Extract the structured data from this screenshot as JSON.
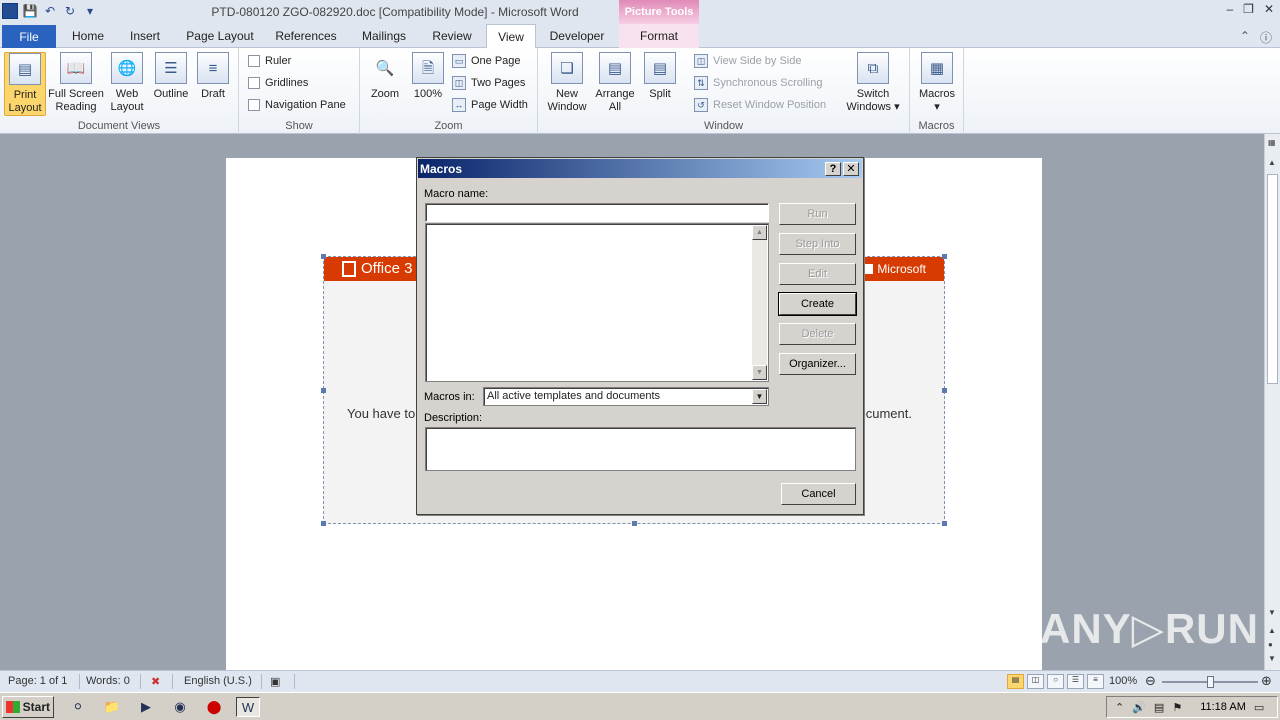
{
  "window": {
    "title": "PTD-080120 ZGO-082920.doc [Compatibility Mode]  -  Microsoft Word",
    "context_tab": "Picture Tools",
    "controls": [
      "–",
      "❐",
      "✕"
    ]
  },
  "tabs": [
    "File",
    "Home",
    "Insert",
    "Page Layout",
    "References",
    "Mailings",
    "Review",
    "View",
    "Developer",
    "Format"
  ],
  "ribbon": {
    "document_views": {
      "label": "Document Views",
      "buttons": [
        "Print\nLayout",
        "Full Screen\nReading",
        "Web\nLayout",
        "Outline",
        "Draft"
      ]
    },
    "show": {
      "label": "Show",
      "items": [
        "Ruler",
        "Gridlines",
        "Navigation Pane"
      ]
    },
    "zoom": {
      "label": "Zoom",
      "zoom_btn": "Zoom",
      "hundred_btn": "100%",
      "items": [
        "One Page",
        "Two Pages",
        "Page Width"
      ]
    },
    "window": {
      "label": "Window",
      "new_window": "New\nWindow",
      "arrange_all": "Arrange\nAll",
      "split": "Split",
      "items": [
        "View Side by Side",
        "Synchronous Scrolling",
        "Reset Window Position"
      ],
      "switch_windows": "Switch\nWindows ▾"
    },
    "macros": {
      "label": "Macros",
      "button": "Macros\n▾"
    }
  },
  "document": {
    "banner_left": "Office 3",
    "banner_right": "Microsoft",
    "text_left": "You have to",
    "text_right": "ocument."
  },
  "dialog": {
    "title": "Macros",
    "help": "?",
    "close": "✕",
    "macro_name_label": "Macro name:",
    "macro_name_value": "",
    "macros_in_label": "Macros in:",
    "macros_in_value": "All active templates and documents",
    "description_label": "Description:",
    "buttons": {
      "run": "Run",
      "step_into": "Step Into",
      "edit": "Edit",
      "create": "Create",
      "delete": "Delete",
      "organizer": "Organizer...",
      "cancel": "Cancel"
    }
  },
  "statusbar": {
    "page": "Page: 1 of 1",
    "words": "Words: 0",
    "language": "English (U.S.)",
    "zoom": "100%"
  },
  "taskbar": {
    "start": "Start",
    "clock": "11:18 AM"
  },
  "watermark": "ANY▷RUN"
}
